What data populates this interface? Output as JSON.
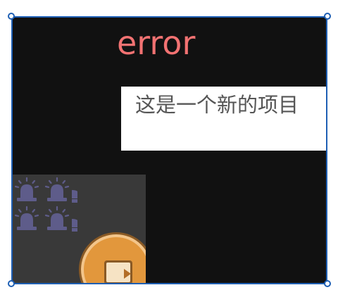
{
  "canvas": {
    "error_label": "error",
    "item_label": "这是一个新的项目"
  },
  "thumbnail": {
    "icons": [
      "siren-icon",
      "siren-icon",
      "siren-icon",
      "siren-icon"
    ],
    "play_icon": "play-icon"
  },
  "colors": {
    "stage_background": "#111111",
    "selection_border": "#1e5fb4",
    "error_text": "#f27272",
    "item_box_background": "#ffffff",
    "item_text": "#555555",
    "siren": "#5e5c8a",
    "coin_orange": "#e2973c"
  }
}
